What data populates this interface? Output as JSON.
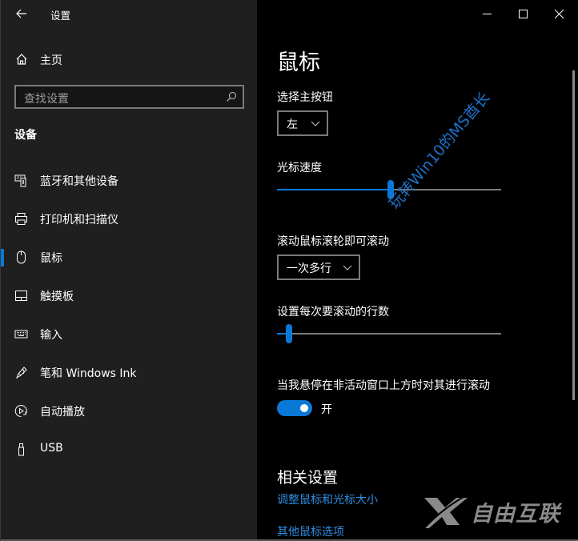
{
  "window": {
    "title": "设置",
    "back_icon": "arrow-left-icon",
    "controls": {
      "minimize": "minimize-icon",
      "maximize": "maximize-icon",
      "close": "close-icon"
    }
  },
  "sidebar": {
    "home": {
      "label": "主页",
      "icon": "home-icon"
    },
    "search": {
      "placeholder": "查找设置",
      "icon": "search-icon"
    },
    "section_title": "设备",
    "items": [
      {
        "label": "蓝牙和其他设备",
        "icon": "bluetooth-devices-icon",
        "selected": false
      },
      {
        "label": "打印机和扫描仪",
        "icon": "printer-icon",
        "selected": false
      },
      {
        "label": "鼠标",
        "icon": "mouse-icon",
        "selected": true
      },
      {
        "label": "触摸板",
        "icon": "touchpad-icon",
        "selected": false
      },
      {
        "label": "输入",
        "icon": "keyboard-icon",
        "selected": false
      },
      {
        "label": "笔和 Windows Ink",
        "icon": "pen-icon",
        "selected": false
      },
      {
        "label": "自动播放",
        "icon": "autoplay-icon",
        "selected": false
      },
      {
        "label": "USB",
        "icon": "usb-icon",
        "selected": false
      }
    ]
  },
  "main": {
    "title": "鼠标",
    "primary_button": {
      "label": "选择主按钮",
      "value": "左"
    },
    "cursor_speed": {
      "label": "光标速度",
      "value": 10,
      "min": 1,
      "max": 20
    },
    "scroll_mode": {
      "label": "滚动鼠标滚轮即可滚动",
      "value": "一次多行"
    },
    "scroll_lines": {
      "label": "设置每次要滚动的行数",
      "value": 3,
      "min": 1,
      "max": 100
    },
    "inactive_scroll": {
      "label": "当我悬停在非活动窗口上方时对其进行滚动",
      "state": true,
      "state_label": "开"
    },
    "related": {
      "title": "相关设置",
      "links": [
        "调整鼠标和光标大小",
        "其他鼠标选项"
      ]
    }
  },
  "overlays": {
    "watermark_text": "玩转Win10的MS酋长",
    "logo_text": "自由互联"
  },
  "colors": {
    "accent": "#0a78d7",
    "link": "#2d8fe3",
    "sidebar_bg": "#1f1f1f",
    "content_bg": "#000000"
  }
}
